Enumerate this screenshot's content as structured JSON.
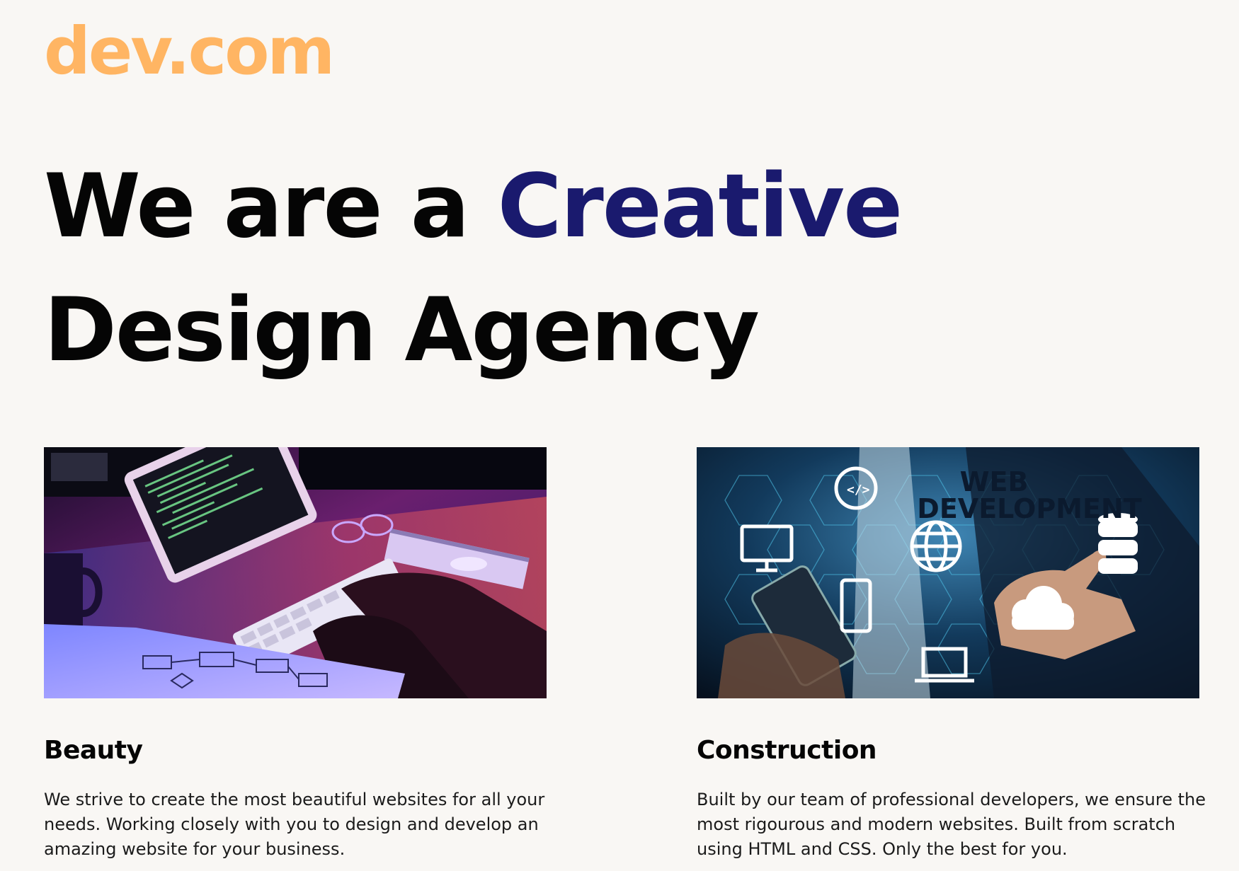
{
  "header": {
    "logo_text": "dev.com",
    "logo_color": "#ffb563"
  },
  "hero": {
    "line1_prefix": "We are a ",
    "line1_accent": "Creative",
    "line2": "Design Agency",
    "accent_color": "#1a1a6e"
  },
  "cards": [
    {
      "title": "Beauty",
      "text": "We strive to create the most beautiful websites for all your needs. Working closely with you to design and develop an amazing website for your business.",
      "image_subject": "person typing on keyboard with tablet showing code, neon purple lighting"
    },
    {
      "title": "Construction",
      "text": "Built by our team of professional developers, we ensure the most rigourous and modern websites. Built from scratch using HTML and CSS. Only the best for you.",
      "image_subject": "web development banner with device icons on hexagon grid",
      "image_text_line1": "WEB",
      "image_text_line2": "DEVELOPMENT"
    }
  ]
}
